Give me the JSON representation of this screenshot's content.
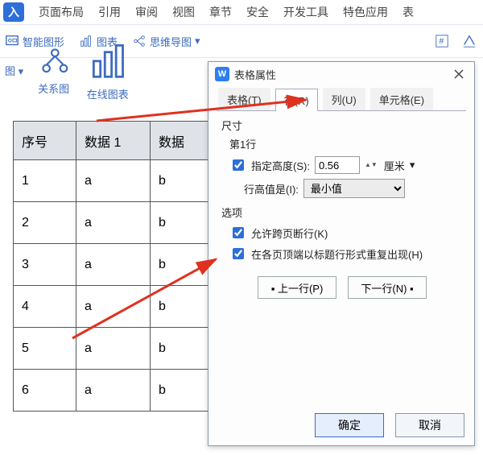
{
  "menubar": {
    "logo": "入",
    "items": [
      "页面布局",
      "引用",
      "审阅",
      "视图",
      "章节",
      "安全",
      "开发工具",
      "特色应用",
      "表"
    ]
  },
  "toolbar": {
    "row1": [
      {
        "icon": "smart-shape",
        "label": "智能图形"
      },
      {
        "icon": "chart",
        "label": "图表"
      },
      {
        "icon": "mindmap",
        "label": "思维导图"
      }
    ],
    "row1_right_icons": [
      "hash-icon",
      "format-icon"
    ],
    "row2": [
      {
        "icon": "chart-group",
        "label": "图 ▾"
      },
      {
        "icon": "relation",
        "label": "关系图"
      },
      {
        "icon": "online-chart",
        "label": "在线图表"
      }
    ]
  },
  "table": {
    "headers": [
      "序号",
      "数据 1",
      "数据"
    ],
    "rows": [
      [
        "1",
        "a",
        "b"
      ],
      [
        "2",
        "a",
        "b"
      ],
      [
        "3",
        "a",
        "b"
      ],
      [
        "4",
        "a",
        "b"
      ],
      [
        "5",
        "a",
        "b"
      ],
      [
        "6",
        "a",
        "b"
      ]
    ]
  },
  "dialog": {
    "title": "表格属性",
    "tabs": [
      "表格(T)",
      "行(R)",
      "列(U)",
      "单元格(E)"
    ],
    "active_tab": 1,
    "size_section": "尺寸",
    "row_label": "第1行",
    "specify_height_label": "指定高度(S):",
    "specify_height_checked": true,
    "height_value": "0.56",
    "height_unit": "厘米",
    "row_height_is_label": "行高值是(I):",
    "row_height_is_value": "最小值",
    "options_section": "选项",
    "allow_break_label": "允许跨页断行(K)",
    "allow_break_checked": true,
    "repeat_header_label": "在各页顶端以标题行形式重复出现(H)",
    "repeat_header_checked": true,
    "prev_row": "上一行(P)",
    "next_row": "下一行(N)",
    "ok": "确定",
    "cancel": "取消"
  }
}
